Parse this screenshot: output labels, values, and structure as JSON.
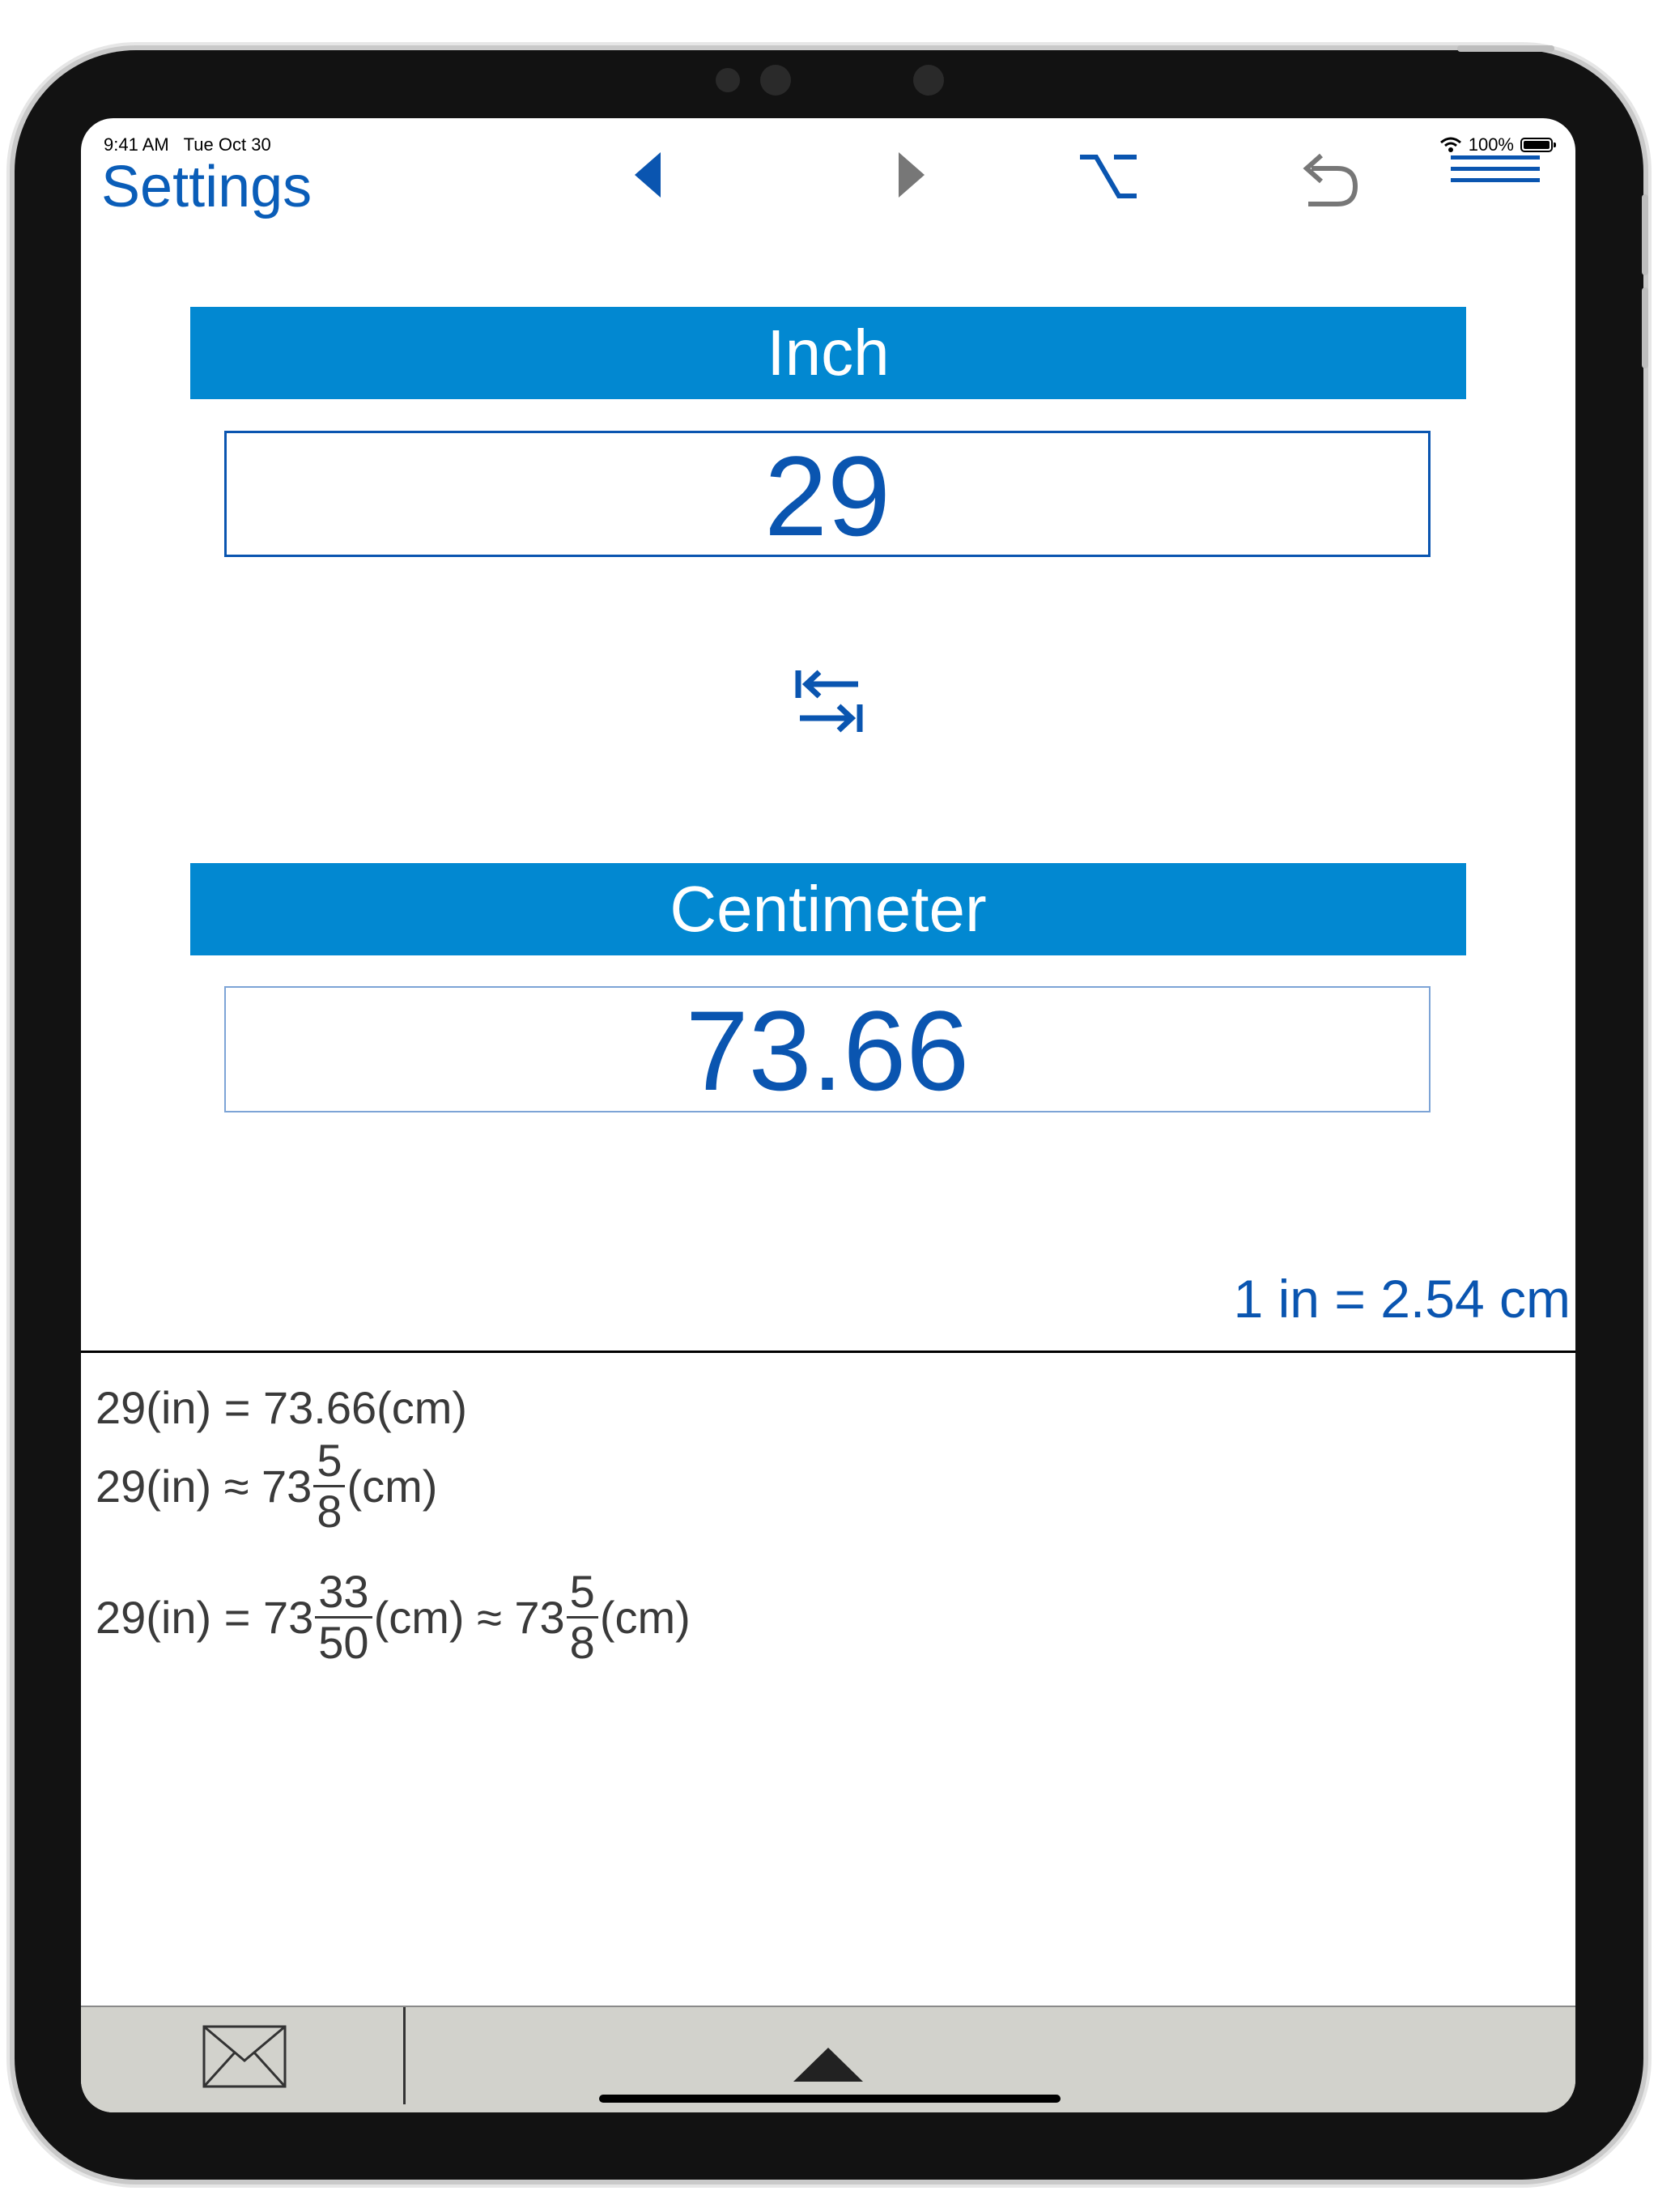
{
  "status": {
    "time": "9:41 AM",
    "date": "Tue Oct 30",
    "battery": "100%"
  },
  "nav": {
    "settings_label": "Settings",
    "icons": [
      "back-triangle-icon",
      "forward-triangle-icon",
      "option-key-icon",
      "undo-icon",
      "menu-icon"
    ]
  },
  "converter": {
    "from_unit": "Inch",
    "from_value": "29",
    "to_unit": "Centimeter",
    "to_value": "73.66",
    "rate": "1 in = 2.54 cm"
  },
  "results": {
    "line1": "29(in) = 73.66(cm)",
    "line2": {
      "prefix": "29(in) ≈ 73",
      "num": "5",
      "den": "8",
      "suffix": "(cm)"
    },
    "line3": {
      "prefix": "29(in) = 73",
      "num1": "33",
      "den1": "50",
      "mid": "(cm) ≈ 73",
      "num2": "5",
      "den2": "8",
      "suffix": "(cm)"
    }
  },
  "colors": {
    "accent": "#0288d1",
    "text_blue": "#0a55b0",
    "bar_bg": "#d2d2cc"
  }
}
